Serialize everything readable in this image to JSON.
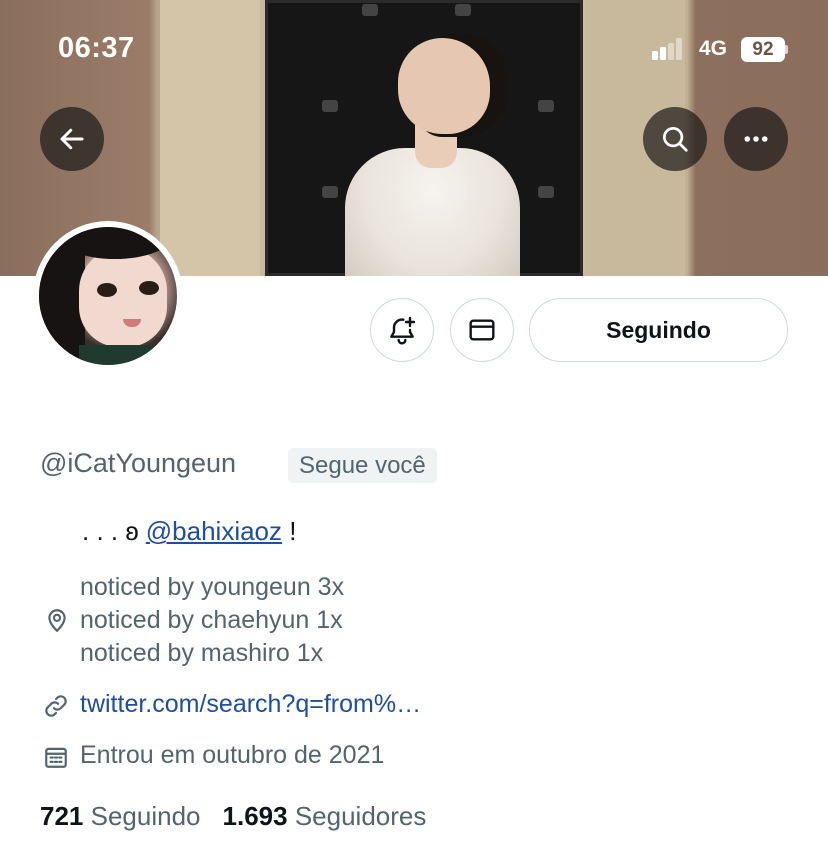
{
  "status_bar": {
    "time": "06:37",
    "network": "4G",
    "battery": "92"
  },
  "header": {
    "back_icon": "arrow-left-icon",
    "search_icon": "search-icon",
    "more_icon": "more-horizontal-icon"
  },
  "actions": {
    "notify_icon": "bell-plus-icon",
    "message_icon": "envelope-icon",
    "follow_label": "Seguindo"
  },
  "profile": {
    "handle": "@iCatYoungeun",
    "follows_you": "Segue você",
    "bio_prefix": ". . . ʚ ",
    "bio_mention": "@bahixiaoz",
    "bio_suffix": " !",
    "location_lines": [
      "noticed by youngeun 3x",
      "noticed by chaehyun 1x",
      "noticed by mashiro 1x"
    ],
    "link": "twitter.com/search?q=from%…",
    "joined": "Entrou em outubro de 2021"
  },
  "stats": {
    "following_count": "721",
    "following_label": "Seguindo",
    "followers_count": "1.693",
    "followers_label": "Seguidores"
  },
  "colors": {
    "link": "#1d4ea3",
    "secondary_text": "#536471",
    "border": "#cfd9de",
    "badge_bg": "#eff3f4"
  }
}
